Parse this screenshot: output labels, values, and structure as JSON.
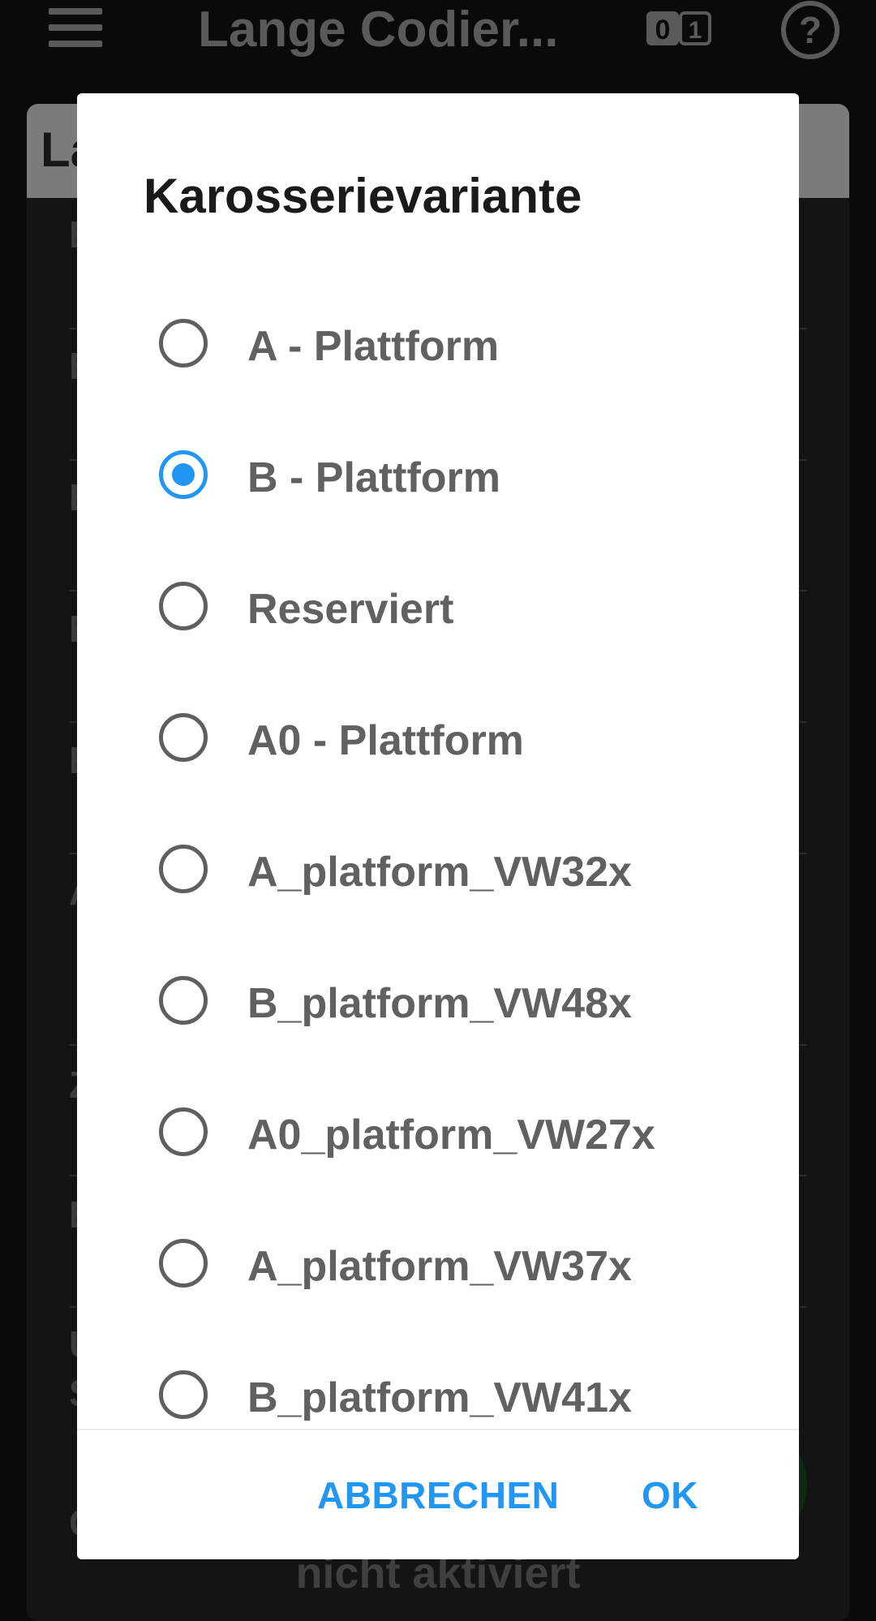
{
  "app": {
    "title": "Lange Codier...",
    "binary_icon_text": "01",
    "help_icon_text": "?",
    "card_header": "La",
    "bg_letters": [
      "B",
      "B",
      "B",
      "B",
      "B",
      "A",
      "Z",
      "B",
      "U",
      "S",
      "C"
    ],
    "bg_bottom_text": "nicht aktiviert"
  },
  "dialog": {
    "title": "Karosserievariante",
    "options": [
      {
        "label": "A - Plattform",
        "selected": false
      },
      {
        "label": "B - Plattform",
        "selected": true
      },
      {
        "label": "Reserviert",
        "selected": false
      },
      {
        "label": "A0 - Plattform",
        "selected": false
      },
      {
        "label": "A_platform_VW32x",
        "selected": false
      },
      {
        "label": "B_platform_VW48x",
        "selected": false
      },
      {
        "label": "A0_platform_VW27x",
        "selected": false
      },
      {
        "label": "A_platform_VW37x",
        "selected": false
      },
      {
        "label": "B_platform_VW41x",
        "selected": false
      }
    ],
    "cancel_label": "ABBRECHEN",
    "ok_label": "OK"
  },
  "colors": {
    "accent": "#2196f3",
    "radio_unchecked": "#5f5f5f",
    "scrim_background": "#0a0a0a"
  }
}
